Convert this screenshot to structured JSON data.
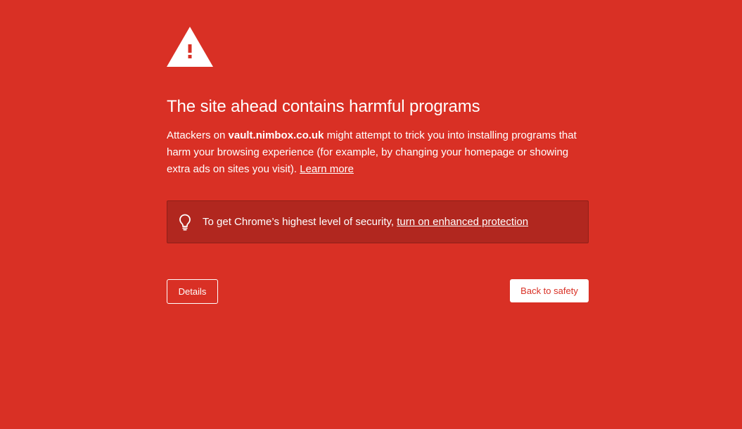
{
  "colors": {
    "background": "#d93025",
    "panel": "#b1271f",
    "text": "#ffffff"
  },
  "icons": {
    "warning": "warning-triangle-icon",
    "tip": "lightbulb-icon"
  },
  "heading": "The site ahead contains harmful programs",
  "explanation": {
    "prefix": "Attackers on ",
    "domain": "vault.nimbox.co.uk",
    "body": " might attempt to trick you into installing programs that harm your browsing experience (for example, by changing your homepage or showing extra ads on sites you visit). ",
    "learn_more": "Learn more"
  },
  "enhanced_protection": {
    "text": "To get Chrome’s highest level of security, ",
    "link": "turn on enhanced protection"
  },
  "buttons": {
    "details": "Details",
    "back_to_safety": "Back to safety"
  }
}
